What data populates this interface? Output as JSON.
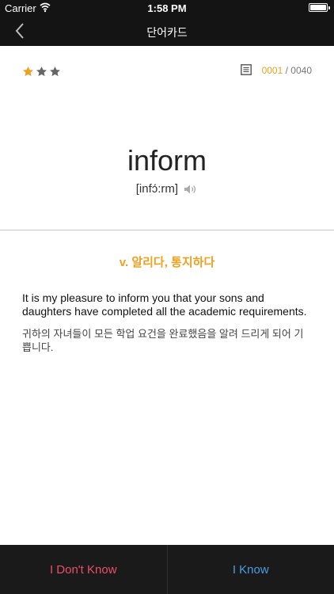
{
  "status_bar": {
    "carrier": "Carrier",
    "time": "1:58 PM",
    "battery_level": 1.0
  },
  "nav": {
    "title": "단어카드"
  },
  "card": {
    "rating": {
      "value": 1,
      "max": 3,
      "active_color": "#f0a020",
      "inactive_color": "#666666"
    },
    "counter": {
      "current": "0001",
      "separator": " / ",
      "total": "0040"
    },
    "word": "inform",
    "pronunciation": "[infɔ́:rm]",
    "meaning": "v. 알리다, 통지하다",
    "example_en": "It is my pleasure to inform you that your sons and daughters have completed all the academic requirements.",
    "example_ko": "귀하의 자녀들이 모든 학업 요건을 완료했음을 알려 드리게 되어 기쁩니다."
  },
  "actions": {
    "dont_know": "I Don't Know",
    "know": "I Know"
  },
  "colors": {
    "accent": "#f0a020",
    "dont_know": "#e9506a",
    "know": "#4a9ee0",
    "bar_bg": "#141414"
  }
}
